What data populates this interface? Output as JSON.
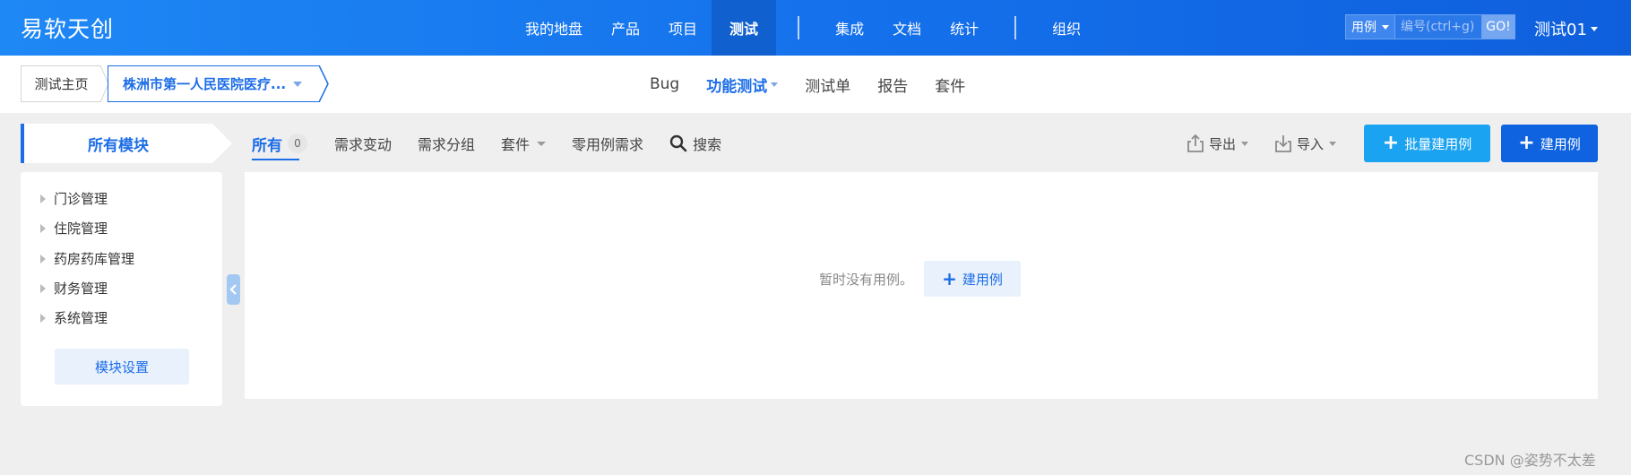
{
  "header": {
    "logo": "易软天创",
    "nav_items": [
      "我的地盘",
      "产品",
      "项目",
      "测试",
      "集成",
      "文档",
      "统计",
      "组织"
    ],
    "active_nav": "测试",
    "search": {
      "type_label": "用例",
      "placeholder": "编号(ctrl+g)",
      "go_label": "GO!"
    },
    "user": "测试01"
  },
  "breadcrumb": {
    "home": "测试主页",
    "product": "株洲市第一人民医院医疗..."
  },
  "subnav": {
    "items": [
      "Bug",
      "功能测试",
      "测试单",
      "报告",
      "套件"
    ],
    "active": "功能测试"
  },
  "module_header": "所有模块",
  "toolbar": {
    "all_label": "所有",
    "all_count": "0",
    "items": [
      "需求变动",
      "需求分组",
      "套件",
      "零用例需求"
    ],
    "search_label": "搜索"
  },
  "actions": {
    "export_label": "导出",
    "import_label": "导入",
    "batch_create_label": "批量建用例",
    "create_label": "建用例"
  },
  "sidebar": {
    "tree": [
      "门诊管理",
      "住院管理",
      "药房药库管理",
      "财务管理",
      "系统管理"
    ],
    "module_setting": "模块设置"
  },
  "main": {
    "empty_text": "暂时没有用例。",
    "empty_create_label": "建用例"
  },
  "watermark": "CSDN @姿势不太差",
  "colors": {
    "brand": "#1c6de8",
    "header_gradient_start": "#1e88f5",
    "header_gradient_end": "#0f5fdd",
    "batch_button": "#1aa3f0",
    "create_button": "#1063e0"
  }
}
